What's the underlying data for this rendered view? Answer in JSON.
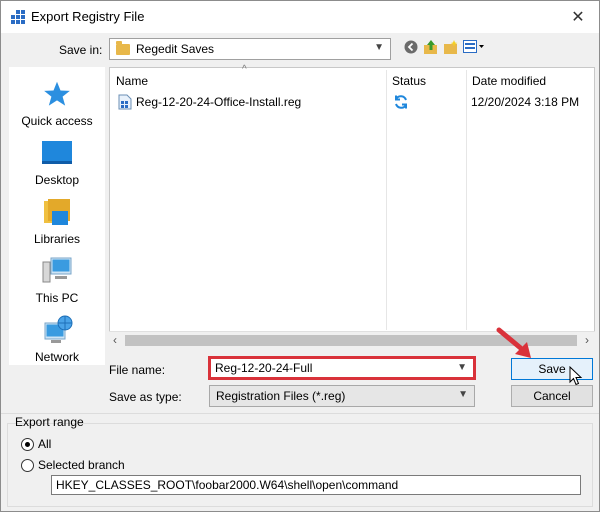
{
  "window": {
    "title": "Export Registry File",
    "close_glyph": "✕"
  },
  "savein": {
    "label": "Save in:",
    "folder": "Regedit Saves"
  },
  "toolbar": {
    "icons": [
      "back-icon",
      "up-folder-icon",
      "new-folder-icon",
      "view-menu-icon"
    ]
  },
  "places": [
    {
      "label": "Quick access",
      "icon": "star-icon"
    },
    {
      "label": "Desktop",
      "icon": "desktop-icon"
    },
    {
      "label": "Libraries",
      "icon": "libraries-icon"
    },
    {
      "label": "This PC",
      "icon": "this-pc-icon"
    },
    {
      "label": "Network",
      "icon": "network-icon"
    }
  ],
  "filelist": {
    "columns": [
      "Name",
      "Status",
      "Date modified"
    ],
    "rows": [
      {
        "name": "Reg-12-20-24-Office-Install.reg",
        "status_icon": "sync-icon",
        "date": "12/20/2024 3:18 PM"
      }
    ]
  },
  "filename": {
    "label": "File name:",
    "value": "Reg-12-20-24-Full"
  },
  "savetype": {
    "label": "Save as type:",
    "value": "Registration Files (*.reg)"
  },
  "buttons": {
    "save": "Save",
    "cancel": "Cancel"
  },
  "export_range": {
    "title": "Export range",
    "all_label": "All",
    "selected_label": "Selected branch",
    "branch_value": "HKEY_CLASSES_ROOT\\foobar2000.W64\\shell\\open\\command"
  },
  "colors": {
    "highlight": "#d9323a",
    "accent": "#0078d7"
  }
}
